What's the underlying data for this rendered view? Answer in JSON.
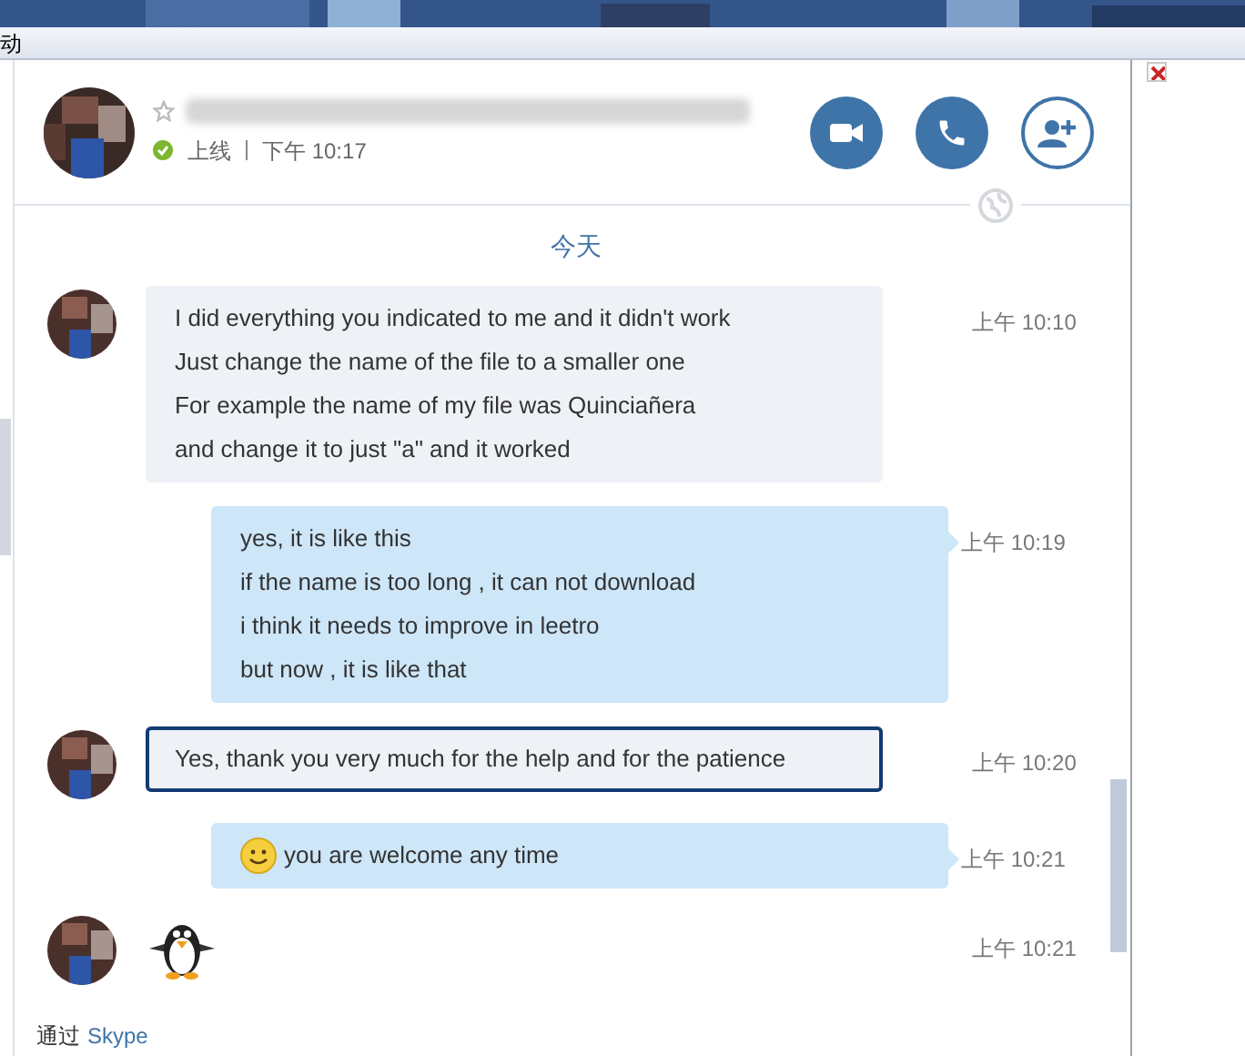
{
  "menu_bar": {
    "label": "动"
  },
  "contact": {
    "status_online": true,
    "status": "上线",
    "last_seen": "下午 10:17"
  },
  "header_buttons": [
    {
      "kind": "video"
    },
    {
      "kind": "call"
    },
    {
      "kind": "add"
    }
  ],
  "day_label": "今天",
  "messages": [
    {
      "kind": "incoming",
      "selected": false,
      "lines": [
        "I did everything you indicated to me and it didn't work",
        "Just change the name of the file to a smaller one",
        "For example the name of my file was Quinciañera",
        "and change it to just \"a\" and it worked"
      ],
      "time": "上午 10:10"
    },
    {
      "kind": "outgoing",
      "selected": false,
      "lines": [
        "yes, it is like this",
        "if the name is too long , it can not download",
        "i think it needs to improve in leetro",
        "but now , it is like that"
      ],
      "time": "上午 10:19"
    },
    {
      "kind": "incoming",
      "selected": true,
      "lines": [
        "Yes, thank you very much for the help and for the patience"
      ],
      "time": "上午 10:20"
    },
    {
      "kind": "outgoing",
      "selected": false,
      "emoticon": true,
      "lines": [
        "you  are welcome any time"
      ],
      "time": "上午 10:21"
    },
    {
      "kind": "sticker",
      "time": "上午 10:21"
    }
  ],
  "footer": {
    "prefix": "通过",
    "link": "Skype"
  }
}
